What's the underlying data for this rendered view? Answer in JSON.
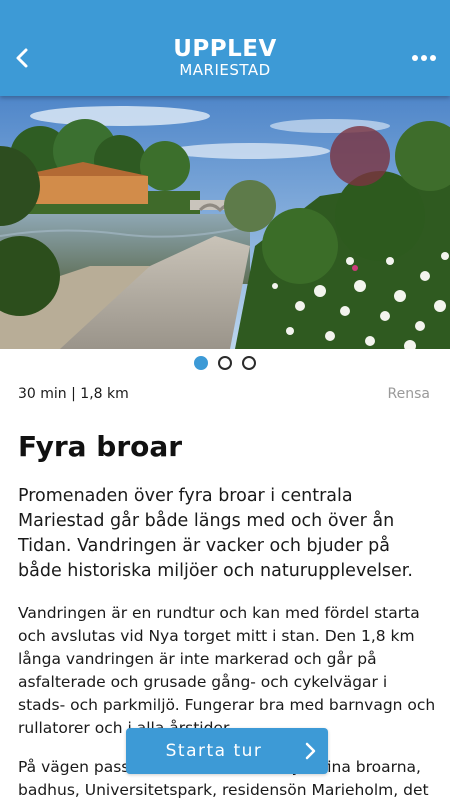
{
  "header": {
    "title": "UPPLEV",
    "subtitle": "MARIESTAD",
    "back_icon": "chevron-left-icon",
    "menu_icon": "more-dots-icon",
    "background_color": "#3d9ad6"
  },
  "carousel": {
    "total": 3,
    "active_index": 0,
    "active_color": "#3d9ad6"
  },
  "route": {
    "meta": "30 min | 1,8 km",
    "clear_label": "Rensa",
    "title": "Fyra broar",
    "lead": "Promenaden över fyra broar i centrala Mariestad går både längs med och över ån Tidan. Vandringen är vacker och bjuder på både historiska miljöer och naturupplevelser.",
    "paragraphs": [
      "Vandringen är en rundtur och kan med fördel starta och avslutas vid Nya torget mitt i stan. Den 1,8 km långa vandringen är inte markerad och går på asfalterade och grusade gång- och cykelvägar i stads- och parkmiljö. Fungerar bra med barnvagn och rullatorer och i alla årstider.",
      "På vägen passerar du, förutom de fyra fina broarna, badhus, Universitetspark, residensön Marieholm, det"
    ]
  },
  "actions": {
    "start_label": "Starta tur",
    "start_icon": "chevron-right-icon"
  }
}
